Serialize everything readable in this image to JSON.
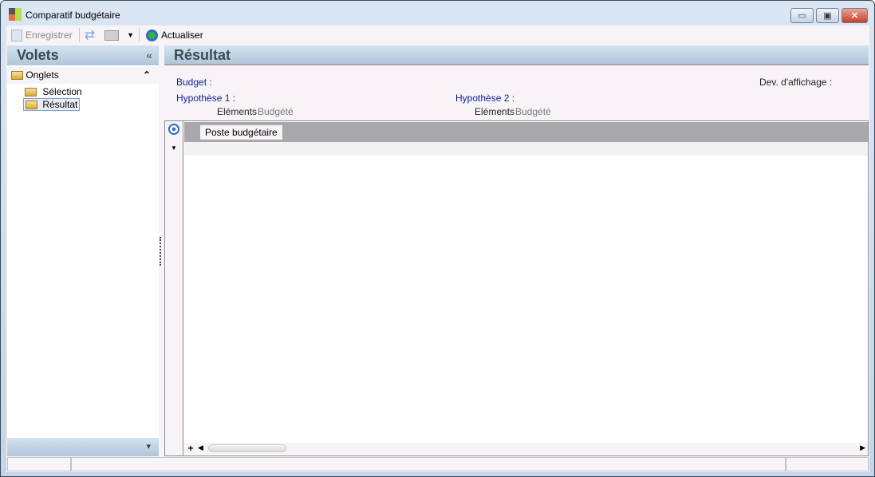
{
  "window": {
    "title": "Comparatif budgétaire",
    "minimize": "▭",
    "restore": "▣",
    "close": "✕"
  },
  "toolbar": {
    "save": "Enregistrer",
    "refresh": "Actualiser"
  },
  "left_pane": {
    "title": "Volets",
    "collapse": "«",
    "group": {
      "label": "Onglets",
      "toggle": "⌃"
    },
    "items": [
      {
        "label": "Sélection"
      },
      {
        "label": "Résultat"
      }
    ],
    "footer_arrow": "▾"
  },
  "right_pane": {
    "title": "Résultat",
    "info": {
      "budget_label": "Budget :",
      "dev_label": "Dev. d'affichage :",
      "hyp1_label": "Hypothèse 1 :",
      "hyp2_label": "Hypothèse 2 :",
      "elements_label": "Eléments",
      "hyp1_elements": "Budgété",
      "hyp2_elements": "Budgété"
    },
    "grid": {
      "column_header": "Poste budgétaire",
      "add": "+"
    }
  }
}
